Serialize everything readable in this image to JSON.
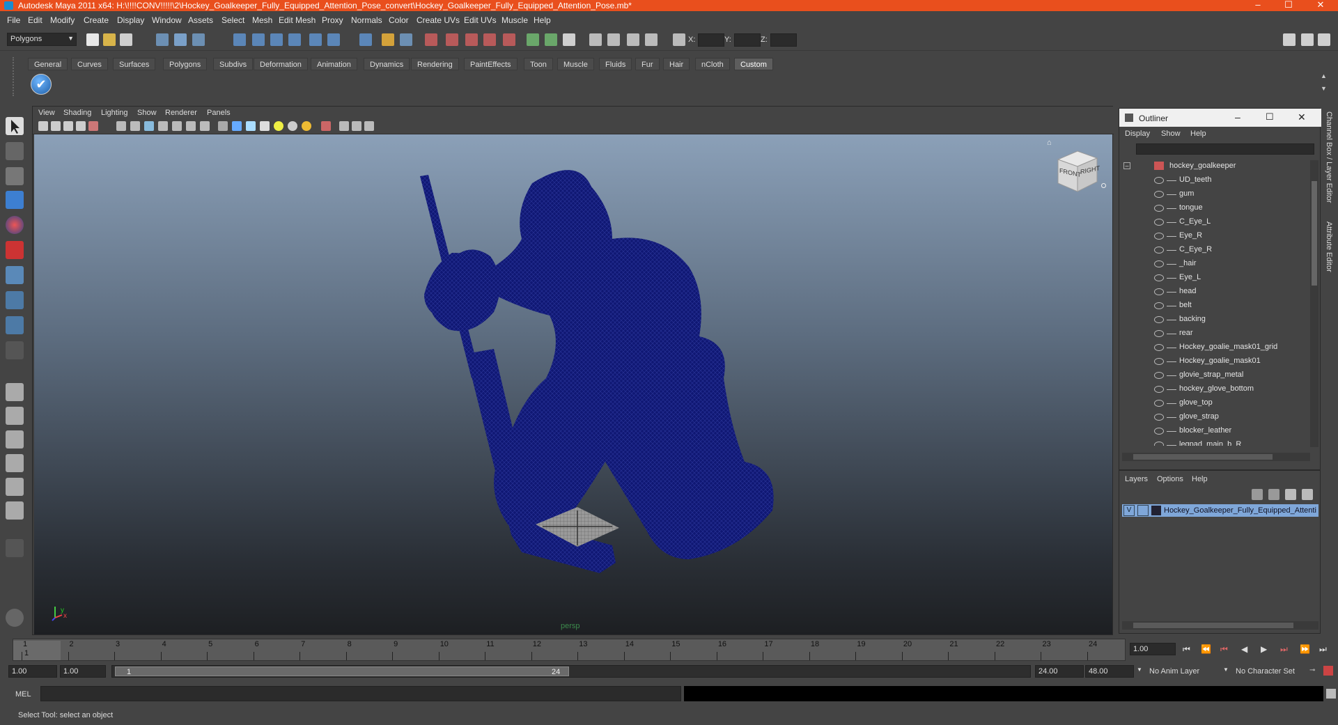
{
  "window": {
    "title": "Autodesk Maya 2011 x64: H:\\!!!!CONV!!!!!\\2\\Hockey_Goalkeeper_Fully_Equipped_Attention_Pose_convert\\Hockey_Goalkeeper_Fully_Equipped_Attention_Pose.mb*",
    "controls": [
      "–",
      "☐",
      "✕"
    ]
  },
  "menu": [
    "File",
    "Edit",
    "Modify",
    "Create",
    "Display",
    "Window",
    "Assets",
    "Select",
    "Mesh",
    "Edit Mesh",
    "Proxy",
    "Normals",
    "Color",
    "Create UVs",
    "Edit UVs",
    "Muscle",
    "Help"
  ],
  "status": {
    "mode_selector": "Polygons",
    "x_label": "X:",
    "y_label": "Y:",
    "z_label": "Z:"
  },
  "shelf_tabs": [
    "General",
    "Curves",
    "Surfaces",
    "Polygons",
    "Subdivs",
    "Deformation",
    "Animation",
    "Dynamics",
    "Rendering",
    "PaintEffects",
    "Toon",
    "Muscle",
    "Fluids",
    "Fur",
    "Hair",
    "nCloth",
    "Custom"
  ],
  "active_shelf": "Custom",
  "viewport": {
    "menu": [
      "View",
      "Shading",
      "Lighting",
      "Show",
      "Renderer",
      "Panels"
    ],
    "camera_label": "persp",
    "viewcube": {
      "front": "FRONT",
      "right": "RIGHT"
    },
    "axis": {
      "x": "x",
      "y": "y"
    }
  },
  "outliner": {
    "title": "Outliner",
    "menu": [
      "Display",
      "Show",
      "Help"
    ],
    "root": "hockey_goalkeeper",
    "items": [
      "UD_teeth",
      "gum",
      "tongue",
      "C_Eye_L",
      "Eye_R",
      "C_Eye_R",
      "_hair",
      "Eye_L",
      "head",
      "belt",
      "backing",
      "rear",
      "Hockey_goalie_mask01_grid",
      "Hockey_goalie_mask01",
      "glovie_strap_metal",
      "hockey_glove_bottom",
      "glove_top",
      "glove_strap",
      "blocker_leather",
      "legpad_main_b_R"
    ]
  },
  "layers": {
    "menu": [
      "Layers",
      "Options",
      "Help"
    ],
    "layer_visible": "V",
    "layer_name": "Hockey_Goalkeeper_Fully_Equipped_Attenti"
  },
  "timeline": {
    "ticks": [
      "1",
      "2",
      "3",
      "4",
      "5",
      "6",
      "7",
      "8",
      "9",
      "10",
      "11",
      "12",
      "13",
      "14",
      "15",
      "16",
      "17",
      "18",
      "19",
      "20",
      "21",
      "22",
      "23",
      "24"
    ],
    "current_frame_marker": "1",
    "current_time": "1.00"
  },
  "range": {
    "start_time": "1.00",
    "playback_start": "1.00",
    "range_start_label": "1",
    "range_end_label": "24",
    "playback_end": "24.00",
    "end_time": "48.00",
    "anim_layer": "No Anim Layer",
    "character_set": "No Character Set"
  },
  "command": {
    "language": "MEL"
  },
  "help_line": "Select Tool: select an object",
  "right_strip": [
    "Channel Box / Layer Editor",
    "Attribute Editor"
  ],
  "colors": {
    "title_bar": "#e94f1d",
    "wireframe": "#101874",
    "selected_layer": "#7fa7d9"
  }
}
